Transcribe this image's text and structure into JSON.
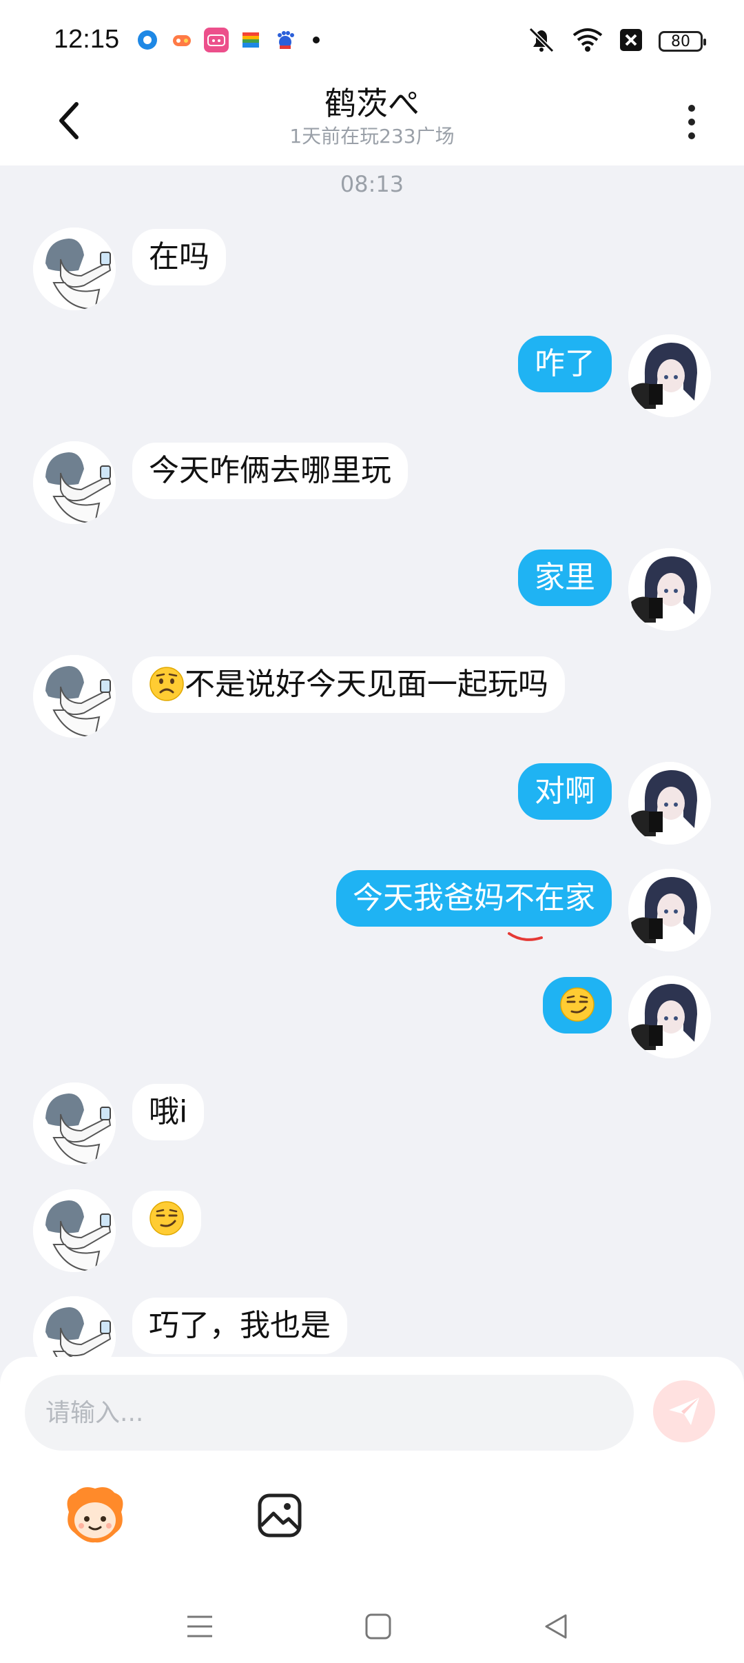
{
  "status_bar": {
    "time": "12:15",
    "battery": "80",
    "notification_apps": [
      "circle-app-icon",
      "game-app-icon",
      "bilibili-app-icon",
      "wallet-app-icon",
      "baidu-app-icon"
    ]
  },
  "header": {
    "title": "鹤茨ぺ",
    "subtitle": "1天前在玩233广场"
  },
  "chat": {
    "timestamp": "08:13",
    "messages": [
      {
        "side": "left",
        "text": "在吗"
      },
      {
        "side": "right",
        "text": "咋了"
      },
      {
        "side": "left",
        "text": "今天咋俩去哪里玩"
      },
      {
        "side": "right",
        "text": "家里"
      },
      {
        "side": "left",
        "text": "不是说好今天见面一起玩吗",
        "emoji": "worried-face"
      },
      {
        "side": "right",
        "text": "对啊"
      },
      {
        "side": "right",
        "text": "今天我爸妈不在家"
      },
      {
        "side": "right",
        "text": "",
        "emoji": "smirk-face"
      },
      {
        "side": "left",
        "text": "哦i"
      },
      {
        "side": "left",
        "text": "",
        "emoji": "smirk-face"
      },
      {
        "side": "left",
        "text": "巧了，我也是"
      }
    ]
  },
  "composer": {
    "placeholder": "请输入..."
  },
  "colors": {
    "bubble_sent": "#1fb3f3",
    "bubble_received": "#ffffff",
    "background": "#f1f2f6",
    "send_button": "#ffe1e0"
  }
}
